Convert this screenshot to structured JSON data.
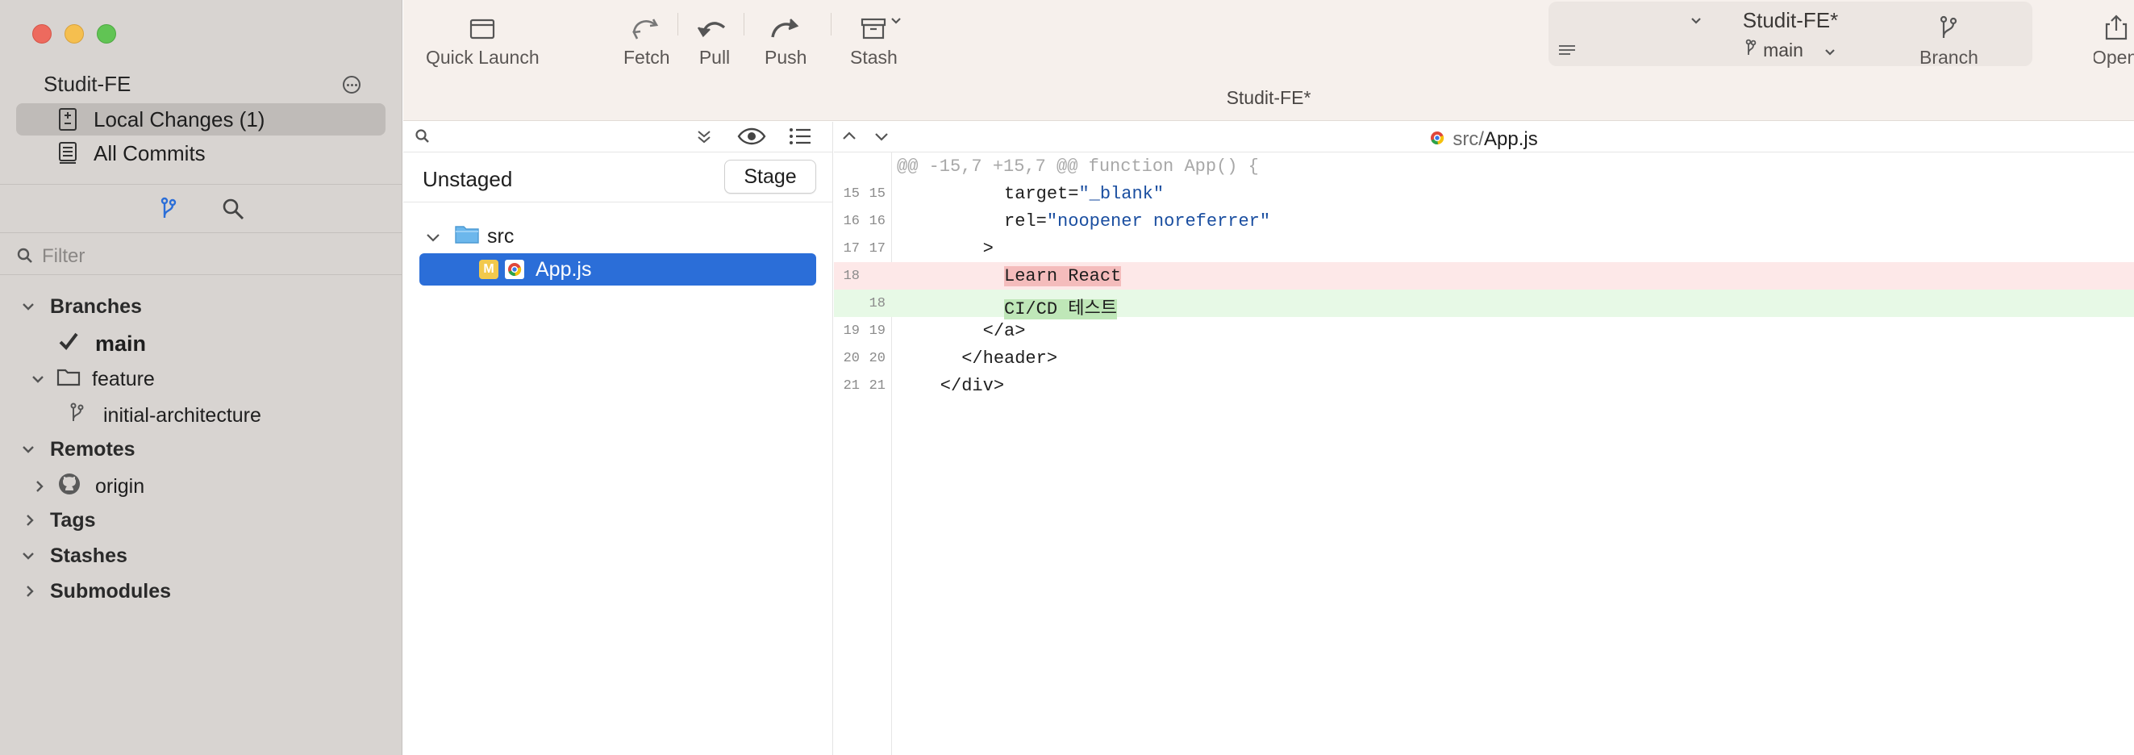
{
  "window": {
    "title": "Studit-FE*"
  },
  "sidebar": {
    "repo_name": "Studit-FE",
    "nav": [
      {
        "label": "Local Changes (1)",
        "icon": "doc-diff-icon",
        "selected": true
      },
      {
        "label": "All Commits",
        "icon": "commits-icon",
        "selected": false
      }
    ],
    "filter_placeholder": "Filter",
    "tree": {
      "branches_label": "Branches",
      "main_branch": "main",
      "feature_folder": "feature",
      "feature_branch": "initial-architecture",
      "remotes_label": "Remotes",
      "origin_label": "origin",
      "tags_label": "Tags",
      "stashes_label": "Stashes",
      "submodules_label": "Submodules"
    }
  },
  "toolbar": {
    "quick_launch": "Quick Launch",
    "fetch": "Fetch",
    "pull": "Pull",
    "push": "Push",
    "stash": "Stash",
    "branch": "Branch",
    "open": "Open",
    "title": "Studit-FE*",
    "current_branch": "main"
  },
  "files": {
    "section_title": "Unstaged",
    "stage_label": "Stage",
    "folder": "src",
    "file": "App.js",
    "file_status": "M"
  },
  "diff": {
    "path_dir": "src/",
    "path_file": "App.js",
    "lines": [
      {
        "type": "hunk",
        "old": "",
        "new": "",
        "code": "@@ -15,7 +15,7 @@ function App() {"
      },
      {
        "type": "ctx",
        "old": "15",
        "new": "15",
        "indent": "          ",
        "attr": "target=",
        "value": "\"_blank\""
      },
      {
        "type": "ctx",
        "old": "16",
        "new": "16",
        "indent": "          ",
        "attr": "rel=",
        "value": "\"noopener noreferrer\""
      },
      {
        "type": "ctx",
        "old": "17",
        "new": "17",
        "code": "        >"
      },
      {
        "type": "del",
        "old": "18",
        "new": "",
        "indent": "          ",
        "hl": "Learn React"
      },
      {
        "type": "add",
        "old": "",
        "new": "18",
        "indent": "          ",
        "hl": "CI/CD 테스트"
      },
      {
        "type": "ctx",
        "old": "19",
        "new": "19",
        "code": "        </a>"
      },
      {
        "type": "ctx",
        "old": "20",
        "new": "20",
        "code": "      </header>"
      },
      {
        "type": "ctx",
        "old": "21",
        "new": "21",
        "code": "    </div>"
      }
    ]
  },
  "colors": {
    "selection_blue": "#2b6ed8",
    "deleted_bg": "#fde8e8",
    "added_bg": "#e7f9e6",
    "modified_badge": "#f2c94c"
  }
}
